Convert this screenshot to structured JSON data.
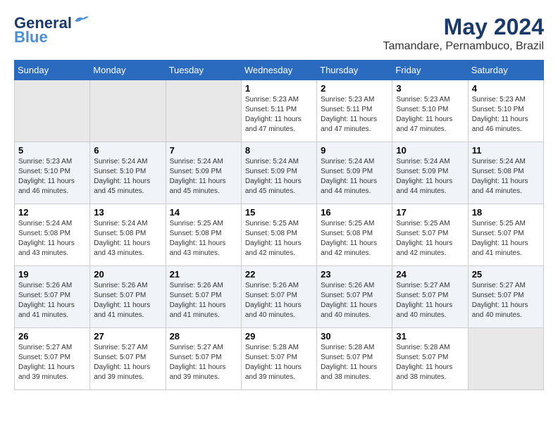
{
  "header": {
    "logo_line1": "General",
    "logo_line2": "Blue",
    "month": "May 2024",
    "location": "Tamandare, Pernambuco, Brazil"
  },
  "days_of_week": [
    "Sunday",
    "Monday",
    "Tuesday",
    "Wednesday",
    "Thursday",
    "Friday",
    "Saturday"
  ],
  "weeks": [
    [
      {
        "day": "",
        "sunrise": "",
        "sunset": "",
        "daylight": ""
      },
      {
        "day": "",
        "sunrise": "",
        "sunset": "",
        "daylight": ""
      },
      {
        "day": "",
        "sunrise": "",
        "sunset": "",
        "daylight": ""
      },
      {
        "day": "1",
        "sunrise": "Sunrise: 5:23 AM",
        "sunset": "Sunset: 5:11 PM",
        "daylight": "Daylight: 11 hours and 47 minutes."
      },
      {
        "day": "2",
        "sunrise": "Sunrise: 5:23 AM",
        "sunset": "Sunset: 5:11 PM",
        "daylight": "Daylight: 11 hours and 47 minutes."
      },
      {
        "day": "3",
        "sunrise": "Sunrise: 5:23 AM",
        "sunset": "Sunset: 5:10 PM",
        "daylight": "Daylight: 11 hours and 47 minutes."
      },
      {
        "day": "4",
        "sunrise": "Sunrise: 5:23 AM",
        "sunset": "Sunset: 5:10 PM",
        "daylight": "Daylight: 11 hours and 46 minutes."
      }
    ],
    [
      {
        "day": "5",
        "sunrise": "Sunrise: 5:23 AM",
        "sunset": "Sunset: 5:10 PM",
        "daylight": "Daylight: 11 hours and 46 minutes."
      },
      {
        "day": "6",
        "sunrise": "Sunrise: 5:24 AM",
        "sunset": "Sunset: 5:10 PM",
        "daylight": "Daylight: 11 hours and 45 minutes."
      },
      {
        "day": "7",
        "sunrise": "Sunrise: 5:24 AM",
        "sunset": "Sunset: 5:09 PM",
        "daylight": "Daylight: 11 hours and 45 minutes."
      },
      {
        "day": "8",
        "sunrise": "Sunrise: 5:24 AM",
        "sunset": "Sunset: 5:09 PM",
        "daylight": "Daylight: 11 hours and 45 minutes."
      },
      {
        "day": "9",
        "sunrise": "Sunrise: 5:24 AM",
        "sunset": "Sunset: 5:09 PM",
        "daylight": "Daylight: 11 hours and 44 minutes."
      },
      {
        "day": "10",
        "sunrise": "Sunrise: 5:24 AM",
        "sunset": "Sunset: 5:09 PM",
        "daylight": "Daylight: 11 hours and 44 minutes."
      },
      {
        "day": "11",
        "sunrise": "Sunrise: 5:24 AM",
        "sunset": "Sunset: 5:08 PM",
        "daylight": "Daylight: 11 hours and 44 minutes."
      }
    ],
    [
      {
        "day": "12",
        "sunrise": "Sunrise: 5:24 AM",
        "sunset": "Sunset: 5:08 PM",
        "daylight": "Daylight: 11 hours and 43 minutes."
      },
      {
        "day": "13",
        "sunrise": "Sunrise: 5:24 AM",
        "sunset": "Sunset: 5:08 PM",
        "daylight": "Daylight: 11 hours and 43 minutes."
      },
      {
        "day": "14",
        "sunrise": "Sunrise: 5:25 AM",
        "sunset": "Sunset: 5:08 PM",
        "daylight": "Daylight: 11 hours and 43 minutes."
      },
      {
        "day": "15",
        "sunrise": "Sunrise: 5:25 AM",
        "sunset": "Sunset: 5:08 PM",
        "daylight": "Daylight: 11 hours and 42 minutes."
      },
      {
        "day": "16",
        "sunrise": "Sunrise: 5:25 AM",
        "sunset": "Sunset: 5:08 PM",
        "daylight": "Daylight: 11 hours and 42 minutes."
      },
      {
        "day": "17",
        "sunrise": "Sunrise: 5:25 AM",
        "sunset": "Sunset: 5:07 PM",
        "daylight": "Daylight: 11 hours and 42 minutes."
      },
      {
        "day": "18",
        "sunrise": "Sunrise: 5:25 AM",
        "sunset": "Sunset: 5:07 PM",
        "daylight": "Daylight: 11 hours and 41 minutes."
      }
    ],
    [
      {
        "day": "19",
        "sunrise": "Sunrise: 5:26 AM",
        "sunset": "Sunset: 5:07 PM",
        "daylight": "Daylight: 11 hours and 41 minutes."
      },
      {
        "day": "20",
        "sunrise": "Sunrise: 5:26 AM",
        "sunset": "Sunset: 5:07 PM",
        "daylight": "Daylight: 11 hours and 41 minutes."
      },
      {
        "day": "21",
        "sunrise": "Sunrise: 5:26 AM",
        "sunset": "Sunset: 5:07 PM",
        "daylight": "Daylight: 11 hours and 41 minutes."
      },
      {
        "day": "22",
        "sunrise": "Sunrise: 5:26 AM",
        "sunset": "Sunset: 5:07 PM",
        "daylight": "Daylight: 11 hours and 40 minutes."
      },
      {
        "day": "23",
        "sunrise": "Sunrise: 5:26 AM",
        "sunset": "Sunset: 5:07 PM",
        "daylight": "Daylight: 11 hours and 40 minutes."
      },
      {
        "day": "24",
        "sunrise": "Sunrise: 5:27 AM",
        "sunset": "Sunset: 5:07 PM",
        "daylight": "Daylight: 11 hours and 40 minutes."
      },
      {
        "day": "25",
        "sunrise": "Sunrise: 5:27 AM",
        "sunset": "Sunset: 5:07 PM",
        "daylight": "Daylight: 11 hours and 40 minutes."
      }
    ],
    [
      {
        "day": "26",
        "sunrise": "Sunrise: 5:27 AM",
        "sunset": "Sunset: 5:07 PM",
        "daylight": "Daylight: 11 hours and 39 minutes."
      },
      {
        "day": "27",
        "sunrise": "Sunrise: 5:27 AM",
        "sunset": "Sunset: 5:07 PM",
        "daylight": "Daylight: 11 hours and 39 minutes."
      },
      {
        "day": "28",
        "sunrise": "Sunrise: 5:27 AM",
        "sunset": "Sunset: 5:07 PM",
        "daylight": "Daylight: 11 hours and 39 minutes."
      },
      {
        "day": "29",
        "sunrise": "Sunrise: 5:28 AM",
        "sunset": "Sunset: 5:07 PM",
        "daylight": "Daylight: 11 hours and 39 minutes."
      },
      {
        "day": "30",
        "sunrise": "Sunrise: 5:28 AM",
        "sunset": "Sunset: 5:07 PM",
        "daylight": "Daylight: 11 hours and 38 minutes."
      },
      {
        "day": "31",
        "sunrise": "Sunrise: 5:28 AM",
        "sunset": "Sunset: 5:07 PM",
        "daylight": "Daylight: 11 hours and 38 minutes."
      },
      {
        "day": "",
        "sunrise": "",
        "sunset": "",
        "daylight": ""
      }
    ]
  ]
}
